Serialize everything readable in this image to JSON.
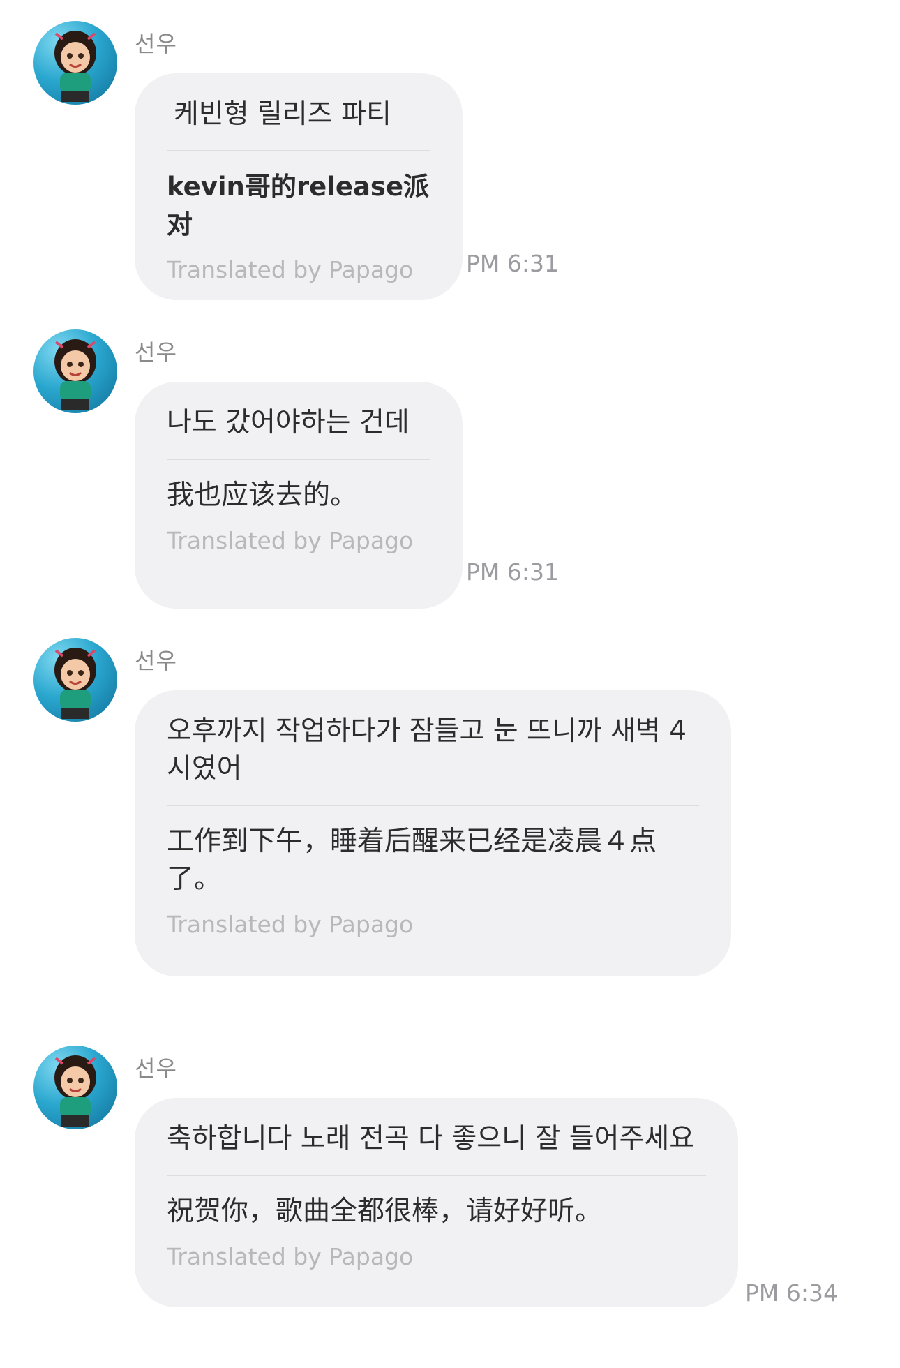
{
  "messages": [
    {
      "sender": "선우",
      "original": "케빈형 릴리즈 파티",
      "translation": "kevin哥的release派对",
      "credit": "Translated by Papago",
      "time": "PM 6:31",
      "avatar_icon": "avatar-icon"
    },
    {
      "sender": "선우",
      "original": "나도 갔어야하는 건데",
      "translation": "我也应该去的。",
      "credit": "Translated by Papago",
      "time": "PM 6:31",
      "avatar_icon": "avatar-icon"
    },
    {
      "sender": "선우",
      "original": "오후까지 작업하다가 잠들고 눈 뜨니까 새벽 4시였어",
      "translation": "工作到下午，睡着后醒来已经是凌晨４点了。",
      "credit": "Translated by Papago",
      "avatar_icon": "avatar-icon"
    },
    {
      "sender": "선우",
      "original": "축하합니다 노래 전곡 다 좋으니 잘 들어주세요",
      "translation": "祝贺你，歌曲全都很棒，请好好听。",
      "credit": "Translated by Papago",
      "time": "PM 6:34",
      "avatar_icon": "avatar-icon"
    }
  ],
  "colors": {
    "bubble": "#f1f1f4",
    "sender": "#8a8a8a",
    "credit": "#b8b8bc",
    "time": "#9c9ca0"
  }
}
